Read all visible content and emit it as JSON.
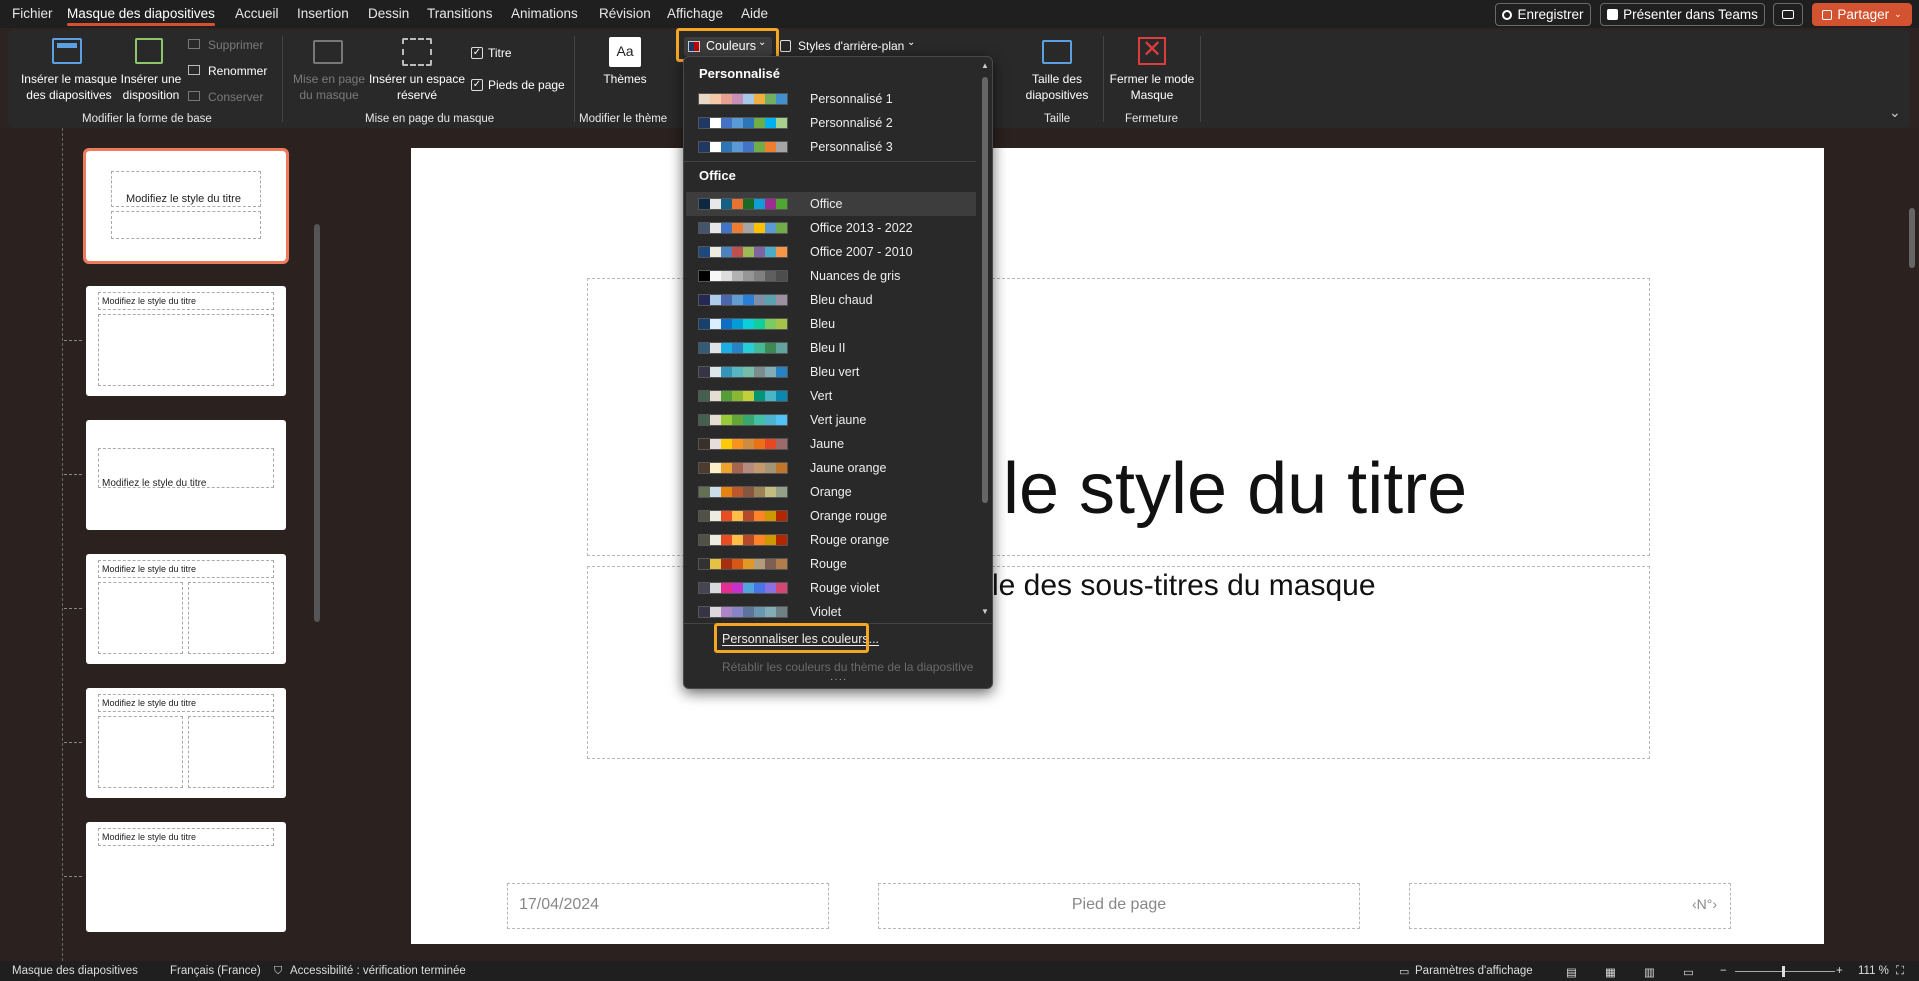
{
  "menubar": {
    "items": [
      "Fichier",
      "Masque des diapositives",
      "Accueil",
      "Insertion",
      "Dessin",
      "Transitions",
      "Animations",
      "Révision",
      "Affichage",
      "Aide"
    ],
    "active": "Masque des diapositives",
    "save_label": "Enregistrer",
    "teams_label": "Présenter dans Teams",
    "share_label": "Partager"
  },
  "ribbon": {
    "insert_master": "Insérer le masque des diapositives",
    "insert_layout": "Insérer une disposition",
    "delete": "Supprimer",
    "rename": "Renommer",
    "preserve": "Conserver",
    "group_edit": "Modifier la forme de base",
    "master_layout": "Mise en page du masque",
    "insert_placeholder": "Insérer un espace réservé",
    "title_chk": "Titre",
    "footers_chk": "Pieds de page",
    "group_layout": "Mise en page du masque",
    "themes": "Thèmes",
    "group_theme": "Modifier le thème",
    "colors": "Couleurs",
    "bg_styles": "Styles d'arrière-plan",
    "slide_size": "Taille des diapositives",
    "group_size": "Taille",
    "close_master": "Fermer le mode Masque",
    "group_close": "Fermeture"
  },
  "dropdown": {
    "custom_header": "Personnalisé",
    "custom": [
      {
        "name": "Personnalisé 1",
        "colors": [
          "#e8d8c8",
          "#f7c8a8",
          "#e8a090",
          "#c890b8",
          "#a8c8e8",
          "#f0b040",
          "#70b060",
          "#4090d0"
        ]
      },
      {
        "name": "Personnalisé 2",
        "colors": [
          "#1f3864",
          "#ffffff",
          "#4472c4",
          "#5b9bd5",
          "#2e75b6",
          "#70ad47",
          "#00b0f0",
          "#a9d18e"
        ]
      },
      {
        "name": "Personnalisé 3",
        "colors": [
          "#1f3864",
          "#ffffff",
          "#2e75b6",
          "#5b9bd5",
          "#4472c4",
          "#70ad47",
          "#ed7d31",
          "#a5a5a5"
        ]
      }
    ],
    "office_header": "Office",
    "office": [
      {
        "name": "Office",
        "colors": [
          "#0e2841",
          "#e8e8e8",
          "#156082",
          "#e97132",
          "#196b24",
          "#0f9ed5",
          "#a02b93",
          "#4ea72e"
        ]
      },
      {
        "name": "Office 2013 - 2022",
        "colors": [
          "#44546a",
          "#e7e6e6",
          "#4472c4",
          "#ed7d31",
          "#a5a5a5",
          "#ffc000",
          "#5b9bd5",
          "#70ad47"
        ]
      },
      {
        "name": "Office 2007 - 2010",
        "colors": [
          "#1f497d",
          "#eeece1",
          "#4f81bd",
          "#c0504d",
          "#9bbb59",
          "#8064a2",
          "#4bacc6",
          "#f79646"
        ]
      },
      {
        "name": "Nuances de gris",
        "colors": [
          "#000000",
          "#f8f8f8",
          "#dddddd",
          "#b2b2b2",
          "#969696",
          "#808080",
          "#5f5f5f",
          "#4d4d4d"
        ]
      },
      {
        "name": "Bleu chaud",
        "colors": [
          "#242852",
          "#acccea",
          "#4a66ac",
          "#629dd1",
          "#297fd5",
          "#7f8fa9",
          "#5aa2ae",
          "#9d90a0"
        ]
      },
      {
        "name": "Bleu",
        "colors": [
          "#17406d",
          "#dbefff",
          "#0f6fc6",
          "#009dd9",
          "#0bd0d9",
          "#10cf9b",
          "#7cca62",
          "#a5c249"
        ]
      },
      {
        "name": "Bleu II",
        "colors": [
          "#335b74",
          "#dfe3e5",
          "#1cade4",
          "#2683c6",
          "#27ced7",
          "#42ba97",
          "#3e8853",
          "#62a39f"
        ]
      },
      {
        "name": "Bleu vert",
        "colors": [
          "#373545",
          "#dce7ea",
          "#3494ba",
          "#58b6c0",
          "#75bda7",
          "#7a8c8e",
          "#84acb6",
          "#2683c6"
        ]
      },
      {
        "name": "Vert",
        "colors": [
          "#455f51",
          "#e3ded1",
          "#549e39",
          "#8ab833",
          "#c0cf3a",
          "#029676",
          "#4ab5c4",
          "#0989b1"
        ]
      },
      {
        "name": "Vert jaune",
        "colors": [
          "#455f51",
          "#e3ded1",
          "#99cb38",
          "#63a537",
          "#37a76f",
          "#44c1a3",
          "#4eb3cf",
          "#51c3f9"
        ]
      },
      {
        "name": "Jaune",
        "colors": [
          "#39302a",
          "#e5dedb",
          "#ffca08",
          "#f8931d",
          "#ce8d3e",
          "#ec7016",
          "#e64823",
          "#9c6a6a"
        ]
      },
      {
        "name": "Jaune orange",
        "colors": [
          "#4e3b30",
          "#fbeec9",
          "#f0a22e",
          "#a5644e",
          "#b58b80",
          "#c3986d",
          "#a19574",
          "#c17529"
        ]
      },
      {
        "name": "Orange",
        "colors": [
          "#637052",
          "#ccddea",
          "#e48312",
          "#bd582c",
          "#865640",
          "#9b8357",
          "#c2bc80",
          "#94a088"
        ]
      },
      {
        "name": "Orange rouge",
        "colors": [
          "#505046",
          "#eeece1",
          "#e84c22",
          "#ffbd47",
          "#b64926",
          "#ff8427",
          "#cc9900",
          "#b22600"
        ]
      },
      {
        "name": "Rouge orange",
        "colors": [
          "#505046",
          "#eeece1",
          "#e84c22",
          "#ffbd47",
          "#b64926",
          "#ff8427",
          "#cc9900",
          "#b22600"
        ]
      },
      {
        "name": "Rouge",
        "colors": [
          "#323232",
          "#e5c243",
          "#a5300f",
          "#d55816",
          "#e19825",
          "#b19c7d",
          "#7f5f52",
          "#b27d49"
        ]
      },
      {
        "name": "Rouge violet",
        "colors": [
          "#454551",
          "#d8d9dc",
          "#e32d91",
          "#c830cc",
          "#4ea6dc",
          "#4775e7",
          "#8971e1",
          "#d54773"
        ]
      },
      {
        "name": "Violet",
        "colors": [
          "#373545",
          "#dcd8dc",
          "#ad84c6",
          "#8784c7",
          "#5d739a",
          "#6997af",
          "#84acb6",
          "#6f8183"
        ]
      }
    ],
    "customize": "Personnaliser les couleurs...",
    "reset": "Rétablir les couleurs du thème de la diapositive"
  },
  "thumbnails": [
    {
      "title": "Modifiez le style du titre"
    },
    {
      "title": "Modifiez le style du titre"
    },
    {
      "title": "Modifiez le style du titre"
    },
    {
      "title": "Modifiez le style du titre"
    },
    {
      "title": "Modifiez le style du titre"
    },
    {
      "title": "Modifiez le style du titre"
    }
  ],
  "slide": {
    "title": "z le style du titre",
    "subtitle": "yle des sous-titres du masque",
    "date": "17/04/2024",
    "footer": "Pied de page",
    "number": "‹N°›"
  },
  "status": {
    "mode": "Masque des diapositives",
    "lang": "Français (France)",
    "accessibility": "Accessibilité : vérification terminée",
    "display_settings": "Paramètres d'affichage",
    "zoom": "111 %"
  }
}
